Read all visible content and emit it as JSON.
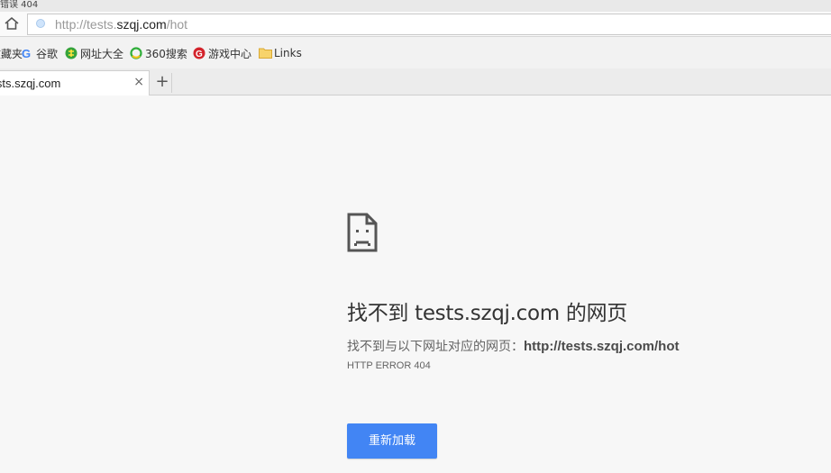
{
  "window": {
    "title_fragment": "错误 404"
  },
  "address_bar": {
    "url_prefix": "http://tests.",
    "url_domain": "szqj.com",
    "url_path": "/hot"
  },
  "bookmarks": [
    {
      "label": "收藏夹",
      "icon": "star-icon"
    },
    {
      "label": "谷歌",
      "icon": "google-icon"
    },
    {
      "label": "网址大全",
      "icon": "web-directory-icon"
    },
    {
      "label": "360搜索",
      "icon": "360-search-icon"
    },
    {
      "label": "游戏中心",
      "icon": "game-center-icon"
    },
    {
      "label": "Links",
      "icon": "folder-icon"
    }
  ],
  "tabs": [
    {
      "title": "tests.szqj.com",
      "close": "×"
    }
  ],
  "new_tab_label": "+",
  "error_page": {
    "title": "找不到 tests.szqj.com 的网页",
    "description_prefix": "找不到与以下网址对应的网页：",
    "description_url": "http://tests.szqj.com/hot",
    "error_code": "HTTP ERROR 404",
    "reload_button": "重新加载",
    "accent_color": "#4285f4"
  }
}
